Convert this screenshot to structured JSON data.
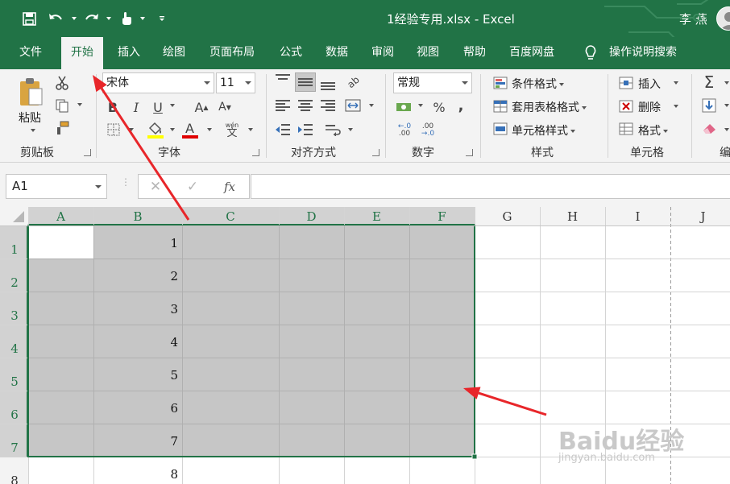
{
  "window": {
    "document_title": "1经验专用.xlsx  -  Excel",
    "user_name": "李 燕"
  },
  "quick_access": [
    "save-icon",
    "undo-icon",
    "redo-icon",
    "touch-mode-icon",
    "customize-icon"
  ],
  "tabs": [
    {
      "label": "文件",
      "active": false
    },
    {
      "label": "开始",
      "active": true
    },
    {
      "label": "插入",
      "active": false
    },
    {
      "label": "绘图",
      "active": false
    },
    {
      "label": "页面布局",
      "active": false
    },
    {
      "label": "公式",
      "active": false
    },
    {
      "label": "数据",
      "active": false
    },
    {
      "label": "审阅",
      "active": false
    },
    {
      "label": "视图",
      "active": false
    },
    {
      "label": "帮助",
      "active": false
    },
    {
      "label": "百度网盘",
      "active": false
    },
    {
      "label": "操作说明搜索",
      "active": false
    }
  ],
  "ribbon": {
    "clipboard": {
      "label": "剪贴板",
      "paste_label": "粘贴"
    },
    "font": {
      "label": "字体",
      "font_name": "宋体",
      "font_size": "11",
      "bold": "B",
      "italic": "I",
      "underline": "U",
      "grow": "A",
      "shrink": "A",
      "font_color_letter": "A",
      "phonetic": "wén\n文",
      "fill_color": "#ffff00",
      "font_color": "#e00000"
    },
    "alignment": {
      "label": "对齐方式"
    },
    "number": {
      "label": "数字",
      "format": "常规",
      "percent": "%",
      "comma": ","
    },
    "styles": {
      "label": "样式",
      "conditional": "条件格式",
      "table_format": "套用表格格式",
      "cell_styles": "单元格样式"
    },
    "cells": {
      "label": "单元格",
      "insert": "插入",
      "delete": "删除",
      "format": "格式"
    },
    "editing": {
      "label": "编",
      "sum": "Σ"
    }
  },
  "formula_bar": {
    "name_box": "A1",
    "fx": "fx",
    "cancel": "✕",
    "enter": "✓",
    "formula": ""
  },
  "sheet": {
    "columns": [
      "A",
      "B",
      "C",
      "D",
      "E",
      "F",
      "G",
      "H",
      "I",
      "J"
    ],
    "rows": [
      "1",
      "2",
      "3",
      "4",
      "5",
      "6",
      "7",
      "8"
    ],
    "b_values": [
      "1",
      "2",
      "3",
      "4",
      "5",
      "6",
      "7",
      "8"
    ],
    "selection": "A1:F7",
    "selection_color": "#c6c6c6",
    "border_color": "#217346"
  },
  "watermark": {
    "text": "Baidu经验",
    "url": "jingyan.baidu.com"
  },
  "colors": {
    "accent": "#217346",
    "arrow": "#e8262a"
  }
}
